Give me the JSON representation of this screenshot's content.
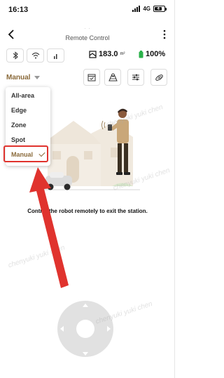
{
  "status_bar": {
    "time": "16:13",
    "network": "4G",
    "battery": "4"
  },
  "header": {
    "small_title": "· ·",
    "title": "Remote Control"
  },
  "robot_info": {
    "area_value": "183.0",
    "area_unit": "m²",
    "battery_percent": "100%"
  },
  "mode": {
    "current": "Manual",
    "options": [
      {
        "label": "All-area",
        "selected": false
      },
      {
        "label": "Edge",
        "selected": false
      },
      {
        "label": "Zone",
        "selected": false
      },
      {
        "label": "Spot",
        "selected": false
      },
      {
        "label": "Manual",
        "selected": true
      }
    ]
  },
  "instruction": "Control the robot remotely to exit the station.",
  "watermarks": [
    "chenyuki yuki chen",
    "chenyuki yuki chen",
    "chenyuki yuki chen",
    "chenyuki yuki chen"
  ],
  "colors": {
    "accent": "#8a6a3a",
    "annotation": "#e0332e",
    "battery_green": "#2bb14a",
    "joystick": "#e1e1e1"
  },
  "icons": [
    "back-arrow-icon",
    "more-options-icon",
    "bluetooth-icon",
    "wifi-icon",
    "signal-icon",
    "map-area-icon",
    "battery-icon",
    "schedule-icon",
    "map-edit-icon",
    "settings-sliders-icon",
    "view-3d-icon",
    "checkmark-icon"
  ]
}
